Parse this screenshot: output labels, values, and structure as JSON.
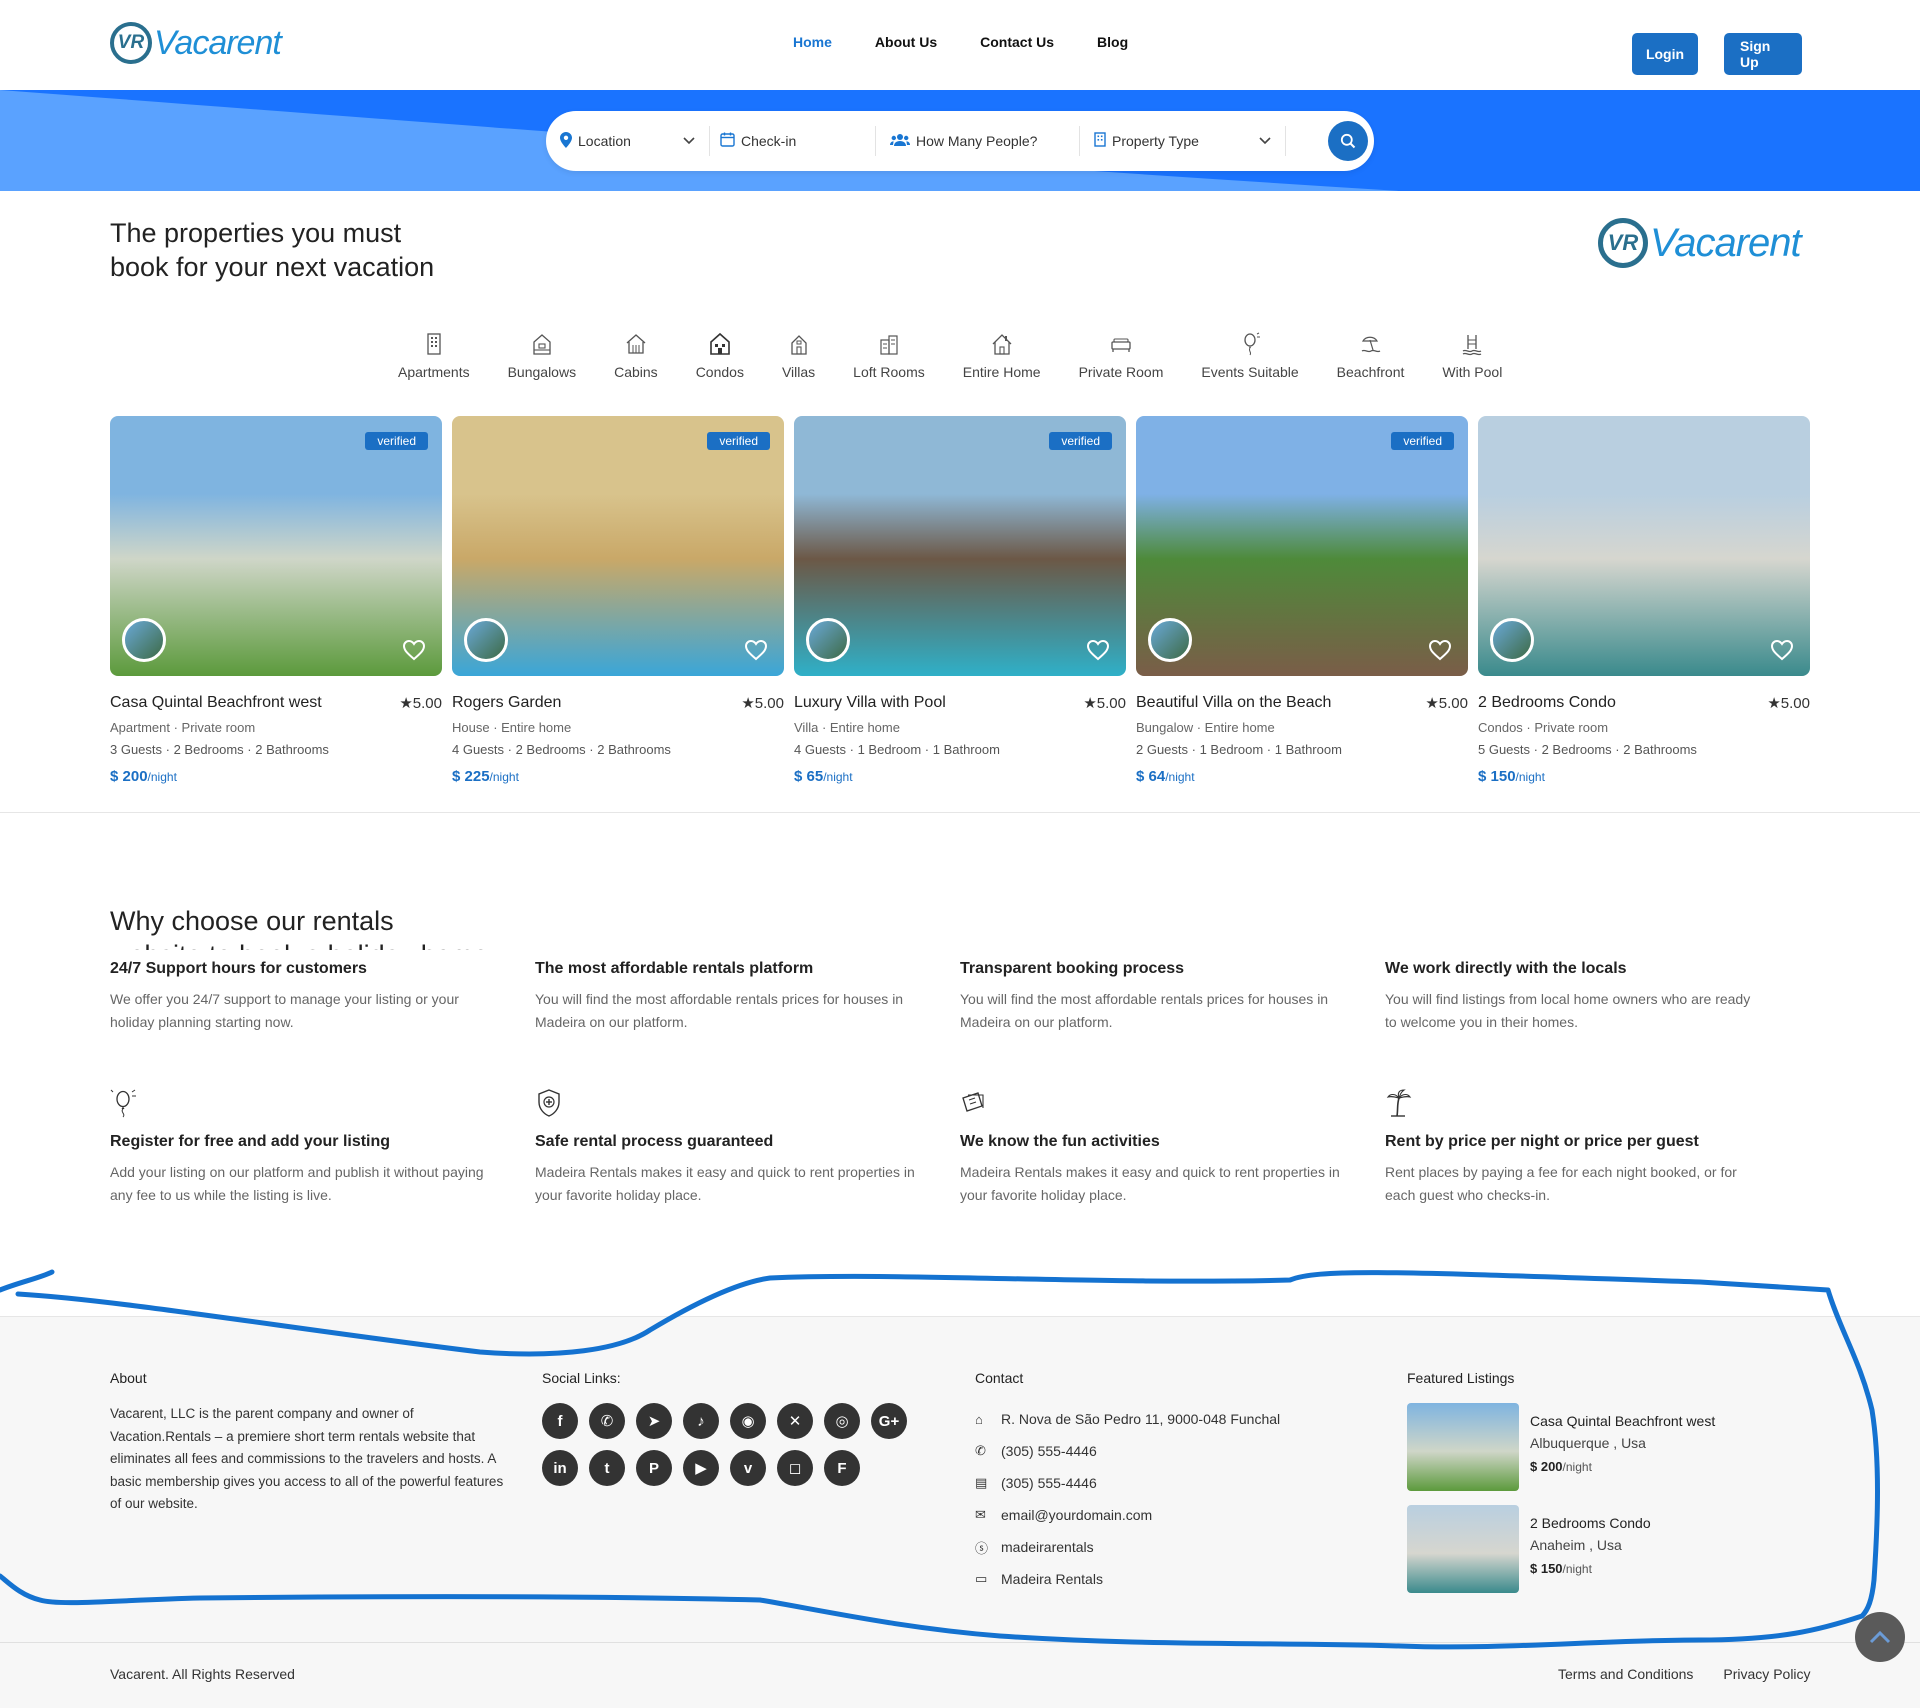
{
  "header": {
    "logo_badge": "VR",
    "logo_text": "Vacarent",
    "nav": [
      {
        "label": "Home",
        "active": true
      },
      {
        "label": "About Us",
        "active": false
      },
      {
        "label": "Contact Us",
        "active": false
      },
      {
        "label": "Blog",
        "active": false
      }
    ],
    "login_label": "Login",
    "signup_label": "Sign Up"
  },
  "search": {
    "location": "Location",
    "checkin": "Check-in",
    "people": "How Many People?",
    "property_type": "Property Type"
  },
  "section": {
    "title_line1": "The properties you must",
    "title_line2": "book for your next vacation"
  },
  "categories": [
    {
      "label": "Apartments",
      "icon": "apartment-icon"
    },
    {
      "label": "Bungalows",
      "icon": "bungalow-icon"
    },
    {
      "label": "Cabins",
      "icon": "cabin-icon"
    },
    {
      "label": "Condos",
      "icon": "condo-icon"
    },
    {
      "label": "Villas",
      "icon": "villa-icon"
    },
    {
      "label": "Loft Rooms",
      "icon": "loft-icon"
    },
    {
      "label": "Entire Home",
      "icon": "home-icon"
    },
    {
      "label": "Private Room",
      "icon": "bed-icon"
    },
    {
      "label": "Events Suitable",
      "icon": "balloon-icon"
    },
    {
      "label": "Beachfront",
      "icon": "beach-icon"
    },
    {
      "label": "With Pool",
      "icon": "pool-icon"
    }
  ],
  "listings": [
    {
      "name": "Casa Quintal Beachfront west",
      "rating": "5.00",
      "sub": "Apartment · Private room",
      "meta": "3 Guests · 2 Bedrooms · 2 Bathrooms",
      "price": "$ 200",
      "unit": "/night",
      "verified": "verified",
      "colors": [
        "#7fb4e0",
        "#cfd6c8",
        "#5c9a3c"
      ]
    },
    {
      "name": "Rogers Garden",
      "rating": "5.00",
      "sub": "House · Entire home",
      "meta": "4 Guests · 2 Bedrooms · 2 Bathrooms",
      "price": "$ 225",
      "unit": "/night",
      "verified": "verified",
      "colors": [
        "#d8c38c",
        "#c9a868",
        "#3aa6d8"
      ]
    },
    {
      "name": "Luxury Villa with Pool",
      "rating": "5.00",
      "sub": "Villa · Entire home",
      "meta": "4 Guests · 1 Bedroom · 1 Bathroom",
      "price": "$ 65",
      "unit": "/night",
      "verified": "verified",
      "colors": [
        "#8fb8d6",
        "#6c5846",
        "#2fb0c8"
      ]
    },
    {
      "name": "Beautiful Villa on the Beach",
      "rating": "5.00",
      "sub": "Bungalow · Entire home",
      "meta": "2 Guests · 1 Bedroom · 1 Bathroom",
      "price": "$ 64",
      "unit": "/night",
      "verified": "verified",
      "colors": [
        "#7fb1e6",
        "#4e8a3a",
        "#7a5d48"
      ]
    },
    {
      "name": "2 Bedrooms Condo",
      "rating": "5.00",
      "sub": "Condos · Private room",
      "meta": "5 Guests · 2 Bedrooms · 2 Bathrooms",
      "price": "$ 150",
      "unit": "/night",
      "verified": "",
      "colors": [
        "#b9cfe0",
        "#d6d6cf",
        "#3a8a8c"
      ]
    }
  ],
  "why": {
    "title_line1": "Why choose our rentals",
    "title_line2": "website to book a holiday home",
    "features": [
      {
        "title": "24/7 Support hours for customers",
        "desc": "We offer you 24/7 support to manage your listing or your holiday planning starting now.",
        "icon": ""
      },
      {
        "title": "The most affordable rentals platform",
        "desc": "You will find the most affordable rentals prices for houses in Madeira on our platform.",
        "icon": ""
      },
      {
        "title": "Transparent booking process",
        "desc": "You will find the most affordable rentals prices for houses in Madeira on our platform.",
        "icon": ""
      },
      {
        "title": "We work directly with the locals",
        "desc": "You will find listings from local home owners who are ready to welcome you in their homes.",
        "icon": ""
      },
      {
        "title": "Register for free and add your listing",
        "desc": "Add your listing on our platform and publish it without paying any fee to us while the listing is live.",
        "icon": "balloon-icon"
      },
      {
        "title": "Safe rental process guaranteed",
        "desc": "Madeira Rentals makes it easy and quick to rent properties in your favorite holiday place.",
        "icon": "shield-icon"
      },
      {
        "title": "We know the fun activities",
        "desc": "Madeira Rentals makes it easy and quick to rent properties in your favorite holiday place.",
        "icon": "tickets-icon"
      },
      {
        "title": "Rent by price per night or price per guest",
        "desc": "Rent places by paying a fee for each night booked, or for each guest who checks-in.",
        "icon": "palm-tree-icon"
      }
    ]
  },
  "footer": {
    "about_title": "About",
    "about_text": "Vacarent, LLC is the parent company and owner of Vacation.Rentals – a premiere short term rentals website that eliminates all fees and commissions to the travelers and hosts. A basic membership gives you access to all of the powerful features of our website.",
    "social_title": "Social Links:",
    "socials": [
      {
        "icon": "facebook-icon",
        "glyph": "f"
      },
      {
        "icon": "whatsapp-icon",
        "glyph": "✆"
      },
      {
        "icon": "telegram-icon",
        "glyph": "➤"
      },
      {
        "icon": "tiktok-icon",
        "glyph": "♪"
      },
      {
        "icon": "rss-icon",
        "glyph": "◉"
      },
      {
        "icon": "xing-icon",
        "glyph": "✕"
      },
      {
        "icon": "dribbble-icon",
        "glyph": "◎"
      },
      {
        "icon": "google-plus-icon",
        "glyph": "G+"
      },
      {
        "icon": "linkedin-icon",
        "glyph": "in"
      },
      {
        "icon": "tumblr-icon",
        "glyph": "t"
      },
      {
        "icon": "pinterest-icon",
        "glyph": "P"
      },
      {
        "icon": "youtube-icon",
        "glyph": "▶"
      },
      {
        "icon": "vimeo-icon",
        "glyph": "v"
      },
      {
        "icon": "instagram-icon",
        "glyph": "◻"
      },
      {
        "icon": "foursquare-icon",
        "glyph": "F"
      }
    ],
    "contact_title": "Contact",
    "contacts": [
      {
        "icon": "home-icon",
        "glyph": "⌂",
        "text": "R. Nova de São Pedro 11, 9000-048 Funchal"
      },
      {
        "icon": "phone-icon",
        "glyph": "✆",
        "text": "(305) 555-4446"
      },
      {
        "icon": "printer-icon",
        "glyph": "▤",
        "text": "(305) 555-4446"
      },
      {
        "icon": "envelope-icon",
        "glyph": "✉",
        "text": "email@yourdomain.com"
      },
      {
        "icon": "skype-icon",
        "glyph": "ⓢ",
        "text": "madeirarentals"
      },
      {
        "icon": "monitor-icon",
        "glyph": "▭",
        "text": "Madeira Rentals"
      }
    ],
    "featured_title": "Featured Listings",
    "featured": [
      {
        "name": "Casa Quintal Beachfront west",
        "location": "Albuquerque , Usa",
        "price": "$ 200",
        "unit": "/night"
      },
      {
        "name": "2 Bedrooms Condo",
        "location": "Anaheim , Usa",
        "price": "$ 150",
        "unit": "/night"
      }
    ],
    "copyright": "Vacarent. All Rights Reserved",
    "terms": "Terms and Conditions",
    "privacy": "Privacy Policy"
  },
  "colors": {
    "brand": "#1b6fc4",
    "band": "#1a73ff",
    "band_light": "#5aa2ff",
    "scribble": "#1472d0"
  }
}
